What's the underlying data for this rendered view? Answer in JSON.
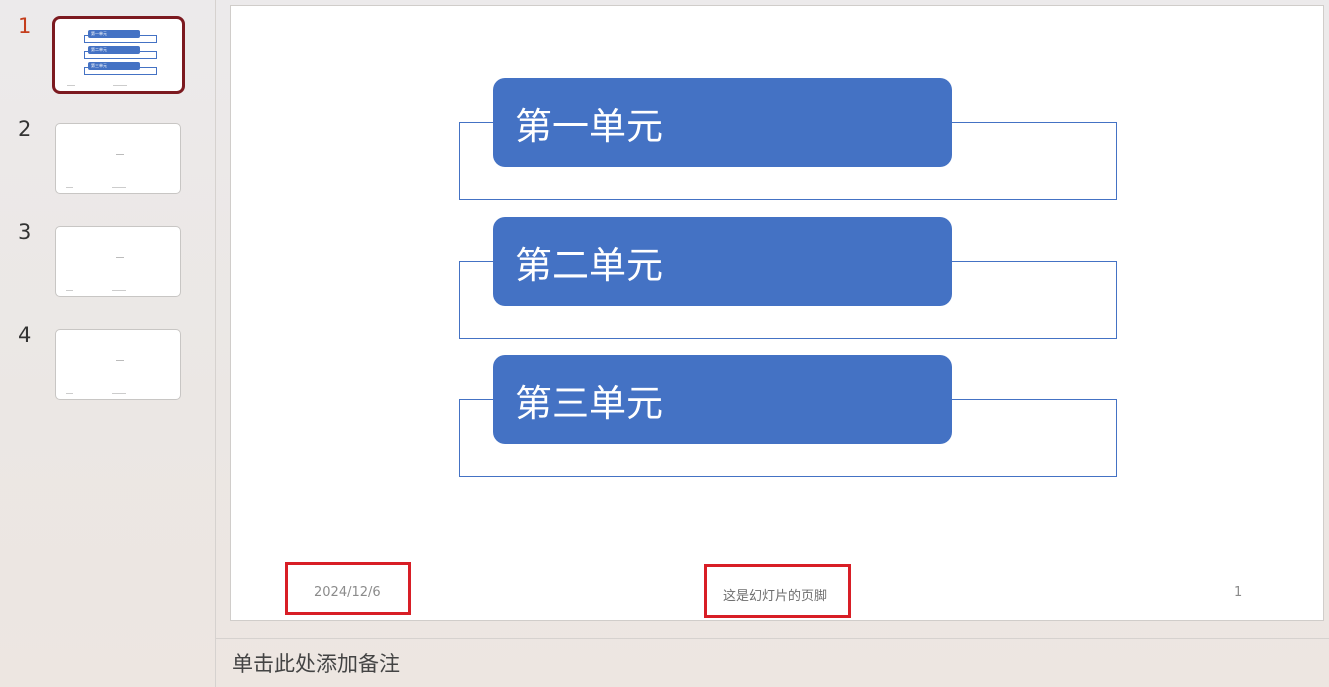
{
  "thumbnails": [
    {
      "number": "1",
      "units": [
        "第一单元",
        "第二单元",
        "第三单元"
      ]
    },
    {
      "number": "2"
    },
    {
      "number": "3"
    },
    {
      "number": "4"
    }
  ],
  "slide": {
    "units": [
      "第一单元",
      "第二单元",
      "第三单元"
    ],
    "footer": {
      "date": "2024/12/6",
      "text": "这是幻灯片的页脚",
      "page_number": "1"
    }
  },
  "notes": {
    "placeholder": "单击此处添加备注"
  },
  "colors": {
    "accent": "#4472c4",
    "active_number": "#c43e1c",
    "selected_border": "#7c1a20",
    "highlight": "#d81e26"
  }
}
